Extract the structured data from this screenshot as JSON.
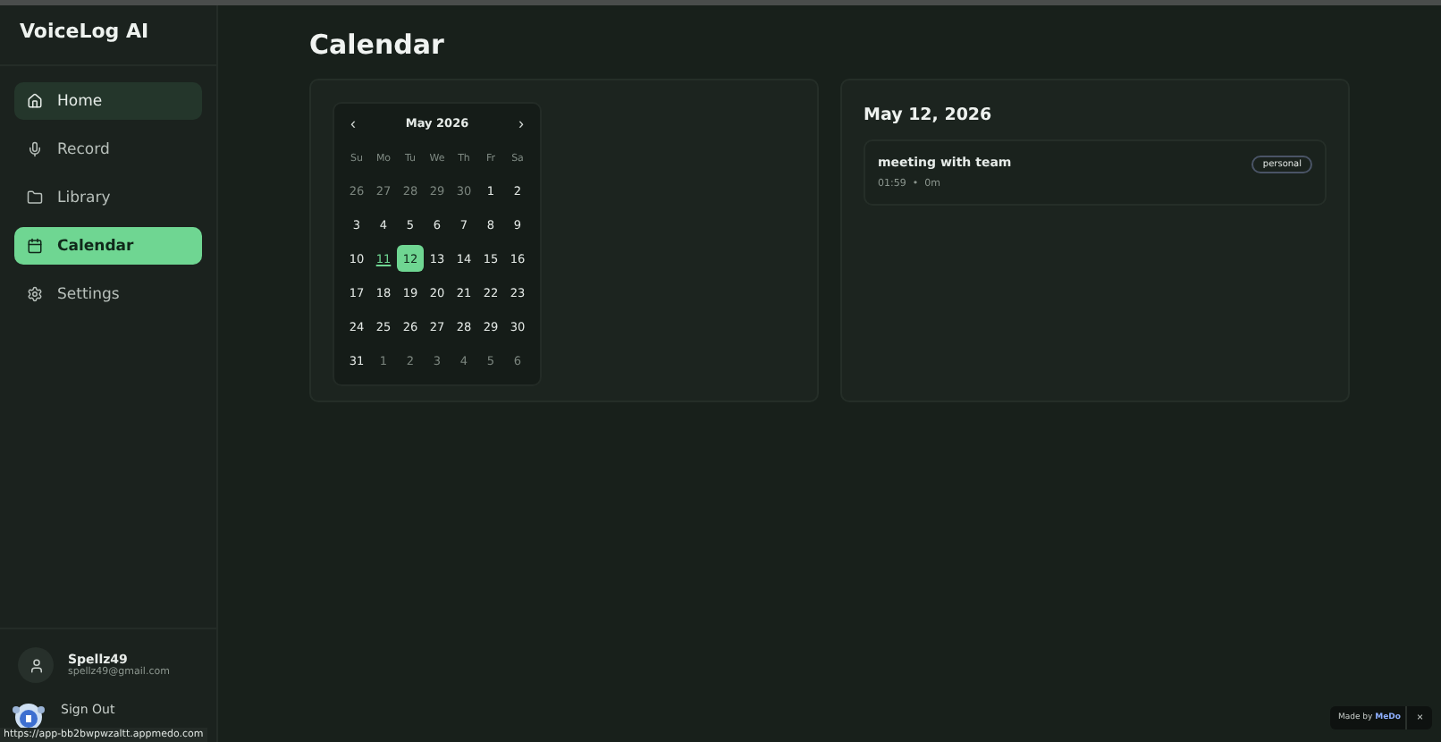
{
  "app": {
    "name": "VoiceLog AI"
  },
  "nav": [
    {
      "label": "Home",
      "selected": false,
      "hover": true
    },
    {
      "label": "Record",
      "selected": false,
      "hover": false
    },
    {
      "label": "Library",
      "selected": false,
      "hover": false
    },
    {
      "label": "Calendar",
      "selected": true,
      "hover": false
    },
    {
      "label": "Settings",
      "selected": false,
      "hover": false
    }
  ],
  "user": {
    "name": "Spellz49",
    "email": "spellz49@gmail.com",
    "sign_out": "Sign Out"
  },
  "page_title": "Calendar",
  "calendar": {
    "month": "May 2026",
    "prev": "‹",
    "next": "›",
    "weekdays": [
      "Su",
      "Mo",
      "Tu",
      "We",
      "Th",
      "Fr",
      "Sa"
    ],
    "days": [
      {
        "label": "26",
        "outside": true,
        "today": false,
        "selected": false
      },
      {
        "label": "27",
        "outside": true,
        "today": false,
        "selected": false
      },
      {
        "label": "28",
        "outside": true,
        "today": false,
        "selected": false
      },
      {
        "label": "29",
        "outside": true,
        "today": false,
        "selected": false
      },
      {
        "label": "30",
        "outside": true,
        "today": false,
        "selected": false
      },
      {
        "label": "1",
        "outside": false,
        "today": false,
        "selected": false
      },
      {
        "label": "2",
        "outside": false,
        "today": false,
        "selected": false
      },
      {
        "label": "3",
        "outside": false,
        "today": false,
        "selected": false
      },
      {
        "label": "4",
        "outside": false,
        "today": false,
        "selected": false
      },
      {
        "label": "5",
        "outside": false,
        "today": false,
        "selected": false
      },
      {
        "label": "6",
        "outside": false,
        "today": false,
        "selected": false
      },
      {
        "label": "7",
        "outside": false,
        "today": false,
        "selected": false
      },
      {
        "label": "8",
        "outside": false,
        "today": false,
        "selected": false
      },
      {
        "label": "9",
        "outside": false,
        "today": false,
        "selected": false
      },
      {
        "label": "10",
        "outside": false,
        "today": false,
        "selected": false
      },
      {
        "label": "11",
        "outside": false,
        "today": true,
        "selected": false
      },
      {
        "label": "12",
        "outside": false,
        "today": false,
        "selected": true
      },
      {
        "label": "13",
        "outside": false,
        "today": false,
        "selected": false
      },
      {
        "label": "14",
        "outside": false,
        "today": false,
        "selected": false
      },
      {
        "label": "15",
        "outside": false,
        "today": false,
        "selected": false
      },
      {
        "label": "16",
        "outside": false,
        "today": false,
        "selected": false
      },
      {
        "label": "17",
        "outside": false,
        "today": false,
        "selected": false
      },
      {
        "label": "18",
        "outside": false,
        "today": false,
        "selected": false
      },
      {
        "label": "19",
        "outside": false,
        "today": false,
        "selected": false
      },
      {
        "label": "20",
        "outside": false,
        "today": false,
        "selected": false
      },
      {
        "label": "21",
        "outside": false,
        "today": false,
        "selected": false
      },
      {
        "label": "22",
        "outside": false,
        "today": false,
        "selected": false
      },
      {
        "label": "23",
        "outside": false,
        "today": false,
        "selected": false
      },
      {
        "label": "24",
        "outside": false,
        "today": false,
        "selected": false
      },
      {
        "label": "25",
        "outside": false,
        "today": false,
        "selected": false
      },
      {
        "label": "26",
        "outside": false,
        "today": false,
        "selected": false
      },
      {
        "label": "27",
        "outside": false,
        "today": false,
        "selected": false
      },
      {
        "label": "28",
        "outside": false,
        "today": false,
        "selected": false
      },
      {
        "label": "29",
        "outside": false,
        "today": false,
        "selected": false
      },
      {
        "label": "30",
        "outside": false,
        "today": false,
        "selected": false
      },
      {
        "label": "31",
        "outside": false,
        "today": false,
        "selected": false
      },
      {
        "label": "1",
        "outside": true,
        "today": false,
        "selected": false
      },
      {
        "label": "2",
        "outside": true,
        "today": false,
        "selected": false
      },
      {
        "label": "3",
        "outside": true,
        "today": false,
        "selected": false
      },
      {
        "label": "4",
        "outside": true,
        "today": false,
        "selected": false
      },
      {
        "label": "5",
        "outside": true,
        "today": false,
        "selected": false
      },
      {
        "label": "6",
        "outside": true,
        "today": false,
        "selected": false
      }
    ]
  },
  "day_panel": {
    "date": "May 12, 2026",
    "events": [
      {
        "title": "meeting with team",
        "time": "01:59",
        "separator": "•",
        "duration": "0m",
        "tag": "personal"
      }
    ]
  },
  "status_url": "https://app-bb2bwpwzaltt.appmedo.com",
  "badge": {
    "text": "Made by",
    "brand": "MeDo",
    "close": "×"
  }
}
